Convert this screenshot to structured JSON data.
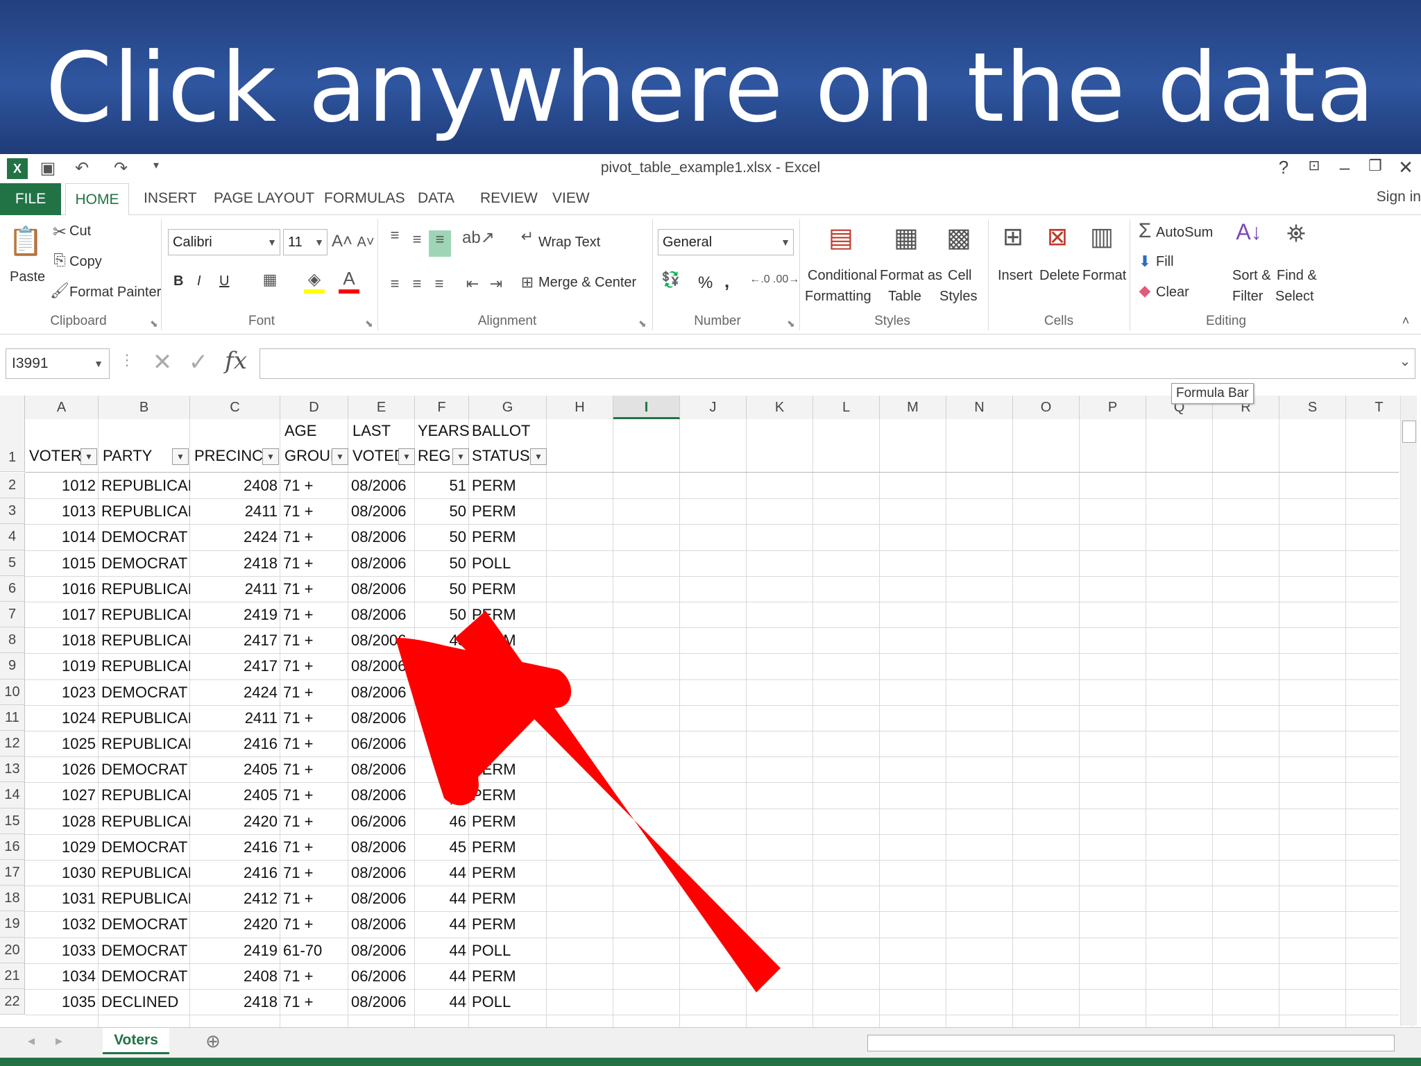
{
  "banner": {
    "title": "Click anywhere on the data"
  },
  "window": {
    "title": "pivot_table_example1.xlsx - Excel",
    "help": "?",
    "sign_in": "Sign in"
  },
  "tabs": [
    "FILE",
    "HOME",
    "INSERT",
    "PAGE LAYOUT",
    "FORMULAS",
    "DATA",
    "REVIEW",
    "VIEW"
  ],
  "ribbon": {
    "clipboard": {
      "paste": "Paste",
      "cut": "Cut",
      "copy": "Copy",
      "format_painter": "Format Painter",
      "label": "Clipboard"
    },
    "font": {
      "name": "Calibri",
      "size": "11",
      "bold": "B",
      "italic": "I",
      "underline": "U",
      "label": "Font"
    },
    "alignment": {
      "wrap": "Wrap Text",
      "merge": "Merge & Center",
      "label": "Alignment"
    },
    "number": {
      "format": "General",
      "percent": "%",
      "comma": ",",
      "label": "Number"
    },
    "styles": {
      "conditional": "Conditional",
      "conditional2": "Formatting",
      "format_as": "Format as",
      "format_as2": "Table",
      "cell": "Cell",
      "cell2": "Styles",
      "label": "Styles"
    },
    "cells": {
      "insert": "Insert",
      "delete": "Delete",
      "format": "Format",
      "label": "Cells"
    },
    "editing": {
      "autosum": "AutoSum",
      "fill": "Fill",
      "clear": "Clear",
      "sort": "Sort &",
      "sort2": "Filter",
      "find": "Find &",
      "find2": "Select",
      "label": "Editing"
    }
  },
  "formula_bar": {
    "name_box": "I3991",
    "value": "",
    "tooltip": "Formula Bar",
    "fx": "fx"
  },
  "columns": [
    "A",
    "B",
    "C",
    "D",
    "E",
    "F",
    "G",
    "H",
    "I",
    "J",
    "K",
    "L",
    "M",
    "N",
    "O",
    "P",
    "Q",
    "R",
    "S",
    "T"
  ],
  "selected_column": "I",
  "headers": {
    "voter": "VOTER",
    "party": "PARTY",
    "precinct": "PRECINCT",
    "age1": "AGE",
    "age2": "GROUP",
    "last1": "LAST",
    "last2": "VOTED",
    "years1": "YEARS",
    "years2": "REG",
    "ballot1": "BALLOT",
    "ballot2": "STATUS"
  },
  "rows": [
    {
      "n": "2",
      "voter": "1012",
      "party": "REPUBLICAN",
      "precinct": "2408",
      "age": "71 +",
      "last": "08/2006",
      "years": "51",
      "ballot": "PERM"
    },
    {
      "n": "3",
      "voter": "1013",
      "party": "REPUBLICAN",
      "precinct": "2411",
      "age": "71 +",
      "last": "08/2006",
      "years": "50",
      "ballot": "PERM"
    },
    {
      "n": "4",
      "voter": "1014",
      "party": "DEMOCRAT",
      "precinct": "2424",
      "age": "71 +",
      "last": "08/2006",
      "years": "50",
      "ballot": "PERM"
    },
    {
      "n": "5",
      "voter": "1015",
      "party": "DEMOCRAT",
      "precinct": "2418",
      "age": "71 +",
      "last": "08/2006",
      "years": "50",
      "ballot": "POLL"
    },
    {
      "n": "6",
      "voter": "1016",
      "party": "REPUBLICAN",
      "precinct": "2411",
      "age": "71 +",
      "last": "08/2006",
      "years": "50",
      "ballot": "PERM"
    },
    {
      "n": "7",
      "voter": "1017",
      "party": "REPUBLICAN",
      "precinct": "2419",
      "age": "71 +",
      "last": "08/2006",
      "years": "50",
      "ballot": "PERM"
    },
    {
      "n": "8",
      "voter": "1018",
      "party": "REPUBLICAN",
      "precinct": "2417",
      "age": "71 +",
      "last": "08/2006",
      "years": "48",
      "ballot": "PERM"
    },
    {
      "n": "9",
      "voter": "1019",
      "party": "REPUBLICAN",
      "precinct": "2417",
      "age": "71 +",
      "last": "08/2006",
      "years": "",
      "ballot": ""
    },
    {
      "n": "10",
      "voter": "1023",
      "party": "DEMOCRAT",
      "precinct": "2424",
      "age": "71 +",
      "last": "08/2006",
      "years": "",
      "ballot": ""
    },
    {
      "n": "11",
      "voter": "1024",
      "party": "REPUBLICAN",
      "precinct": "2411",
      "age": "71 +",
      "last": "08/2006",
      "years": "",
      "ballot": ""
    },
    {
      "n": "12",
      "voter": "1025",
      "party": "REPUBLICAN",
      "precinct": "2416",
      "age": "71 +",
      "last": "06/2006",
      "years": "",
      "ballot": ""
    },
    {
      "n": "13",
      "voter": "1026",
      "party": "DEMOCRAT",
      "precinct": "2405",
      "age": "71 +",
      "last": "08/2006",
      "years": "",
      "ballot": "PERM"
    },
    {
      "n": "14",
      "voter": "1027",
      "party": "REPUBLICAN",
      "precinct": "2405",
      "age": "71 +",
      "last": "08/2006",
      "years": "",
      "ballot": "PERM"
    },
    {
      "n": "15",
      "voter": "1028",
      "party": "REPUBLICAN",
      "precinct": "2420",
      "age": "71 +",
      "last": "06/2006",
      "years": "46",
      "ballot": "PERM"
    },
    {
      "n": "16",
      "voter": "1029",
      "party": "DEMOCRAT",
      "precinct": "2416",
      "age": "71 +",
      "last": "08/2006",
      "years": "45",
      "ballot": "PERM"
    },
    {
      "n": "17",
      "voter": "1030",
      "party": "REPUBLICAN",
      "precinct": "2416",
      "age": "71 +",
      "last": "08/2006",
      "years": "44",
      "ballot": "PERM"
    },
    {
      "n": "18",
      "voter": "1031",
      "party": "REPUBLICAN",
      "precinct": "2412",
      "age": "71 +",
      "last": "08/2006",
      "years": "44",
      "ballot": "PERM"
    },
    {
      "n": "19",
      "voter": "1032",
      "party": "DEMOCRAT",
      "precinct": "2420",
      "age": "71 +",
      "last": "08/2006",
      "years": "44",
      "ballot": "PERM"
    },
    {
      "n": "20",
      "voter": "1033",
      "party": "DEMOCRAT",
      "precinct": "2419",
      "age": "61-70",
      "last": "08/2006",
      "years": "44",
      "ballot": "POLL"
    },
    {
      "n": "21",
      "voter": "1034",
      "party": "DEMOCRAT",
      "precinct": "2408",
      "age": "71 +",
      "last": "06/2006",
      "years": "44",
      "ballot": "PERM"
    },
    {
      "n": "22",
      "voter": "1035",
      "party": "DECLINED",
      "precinct": "2418",
      "age": "71 +",
      "last": "08/2006",
      "years": "44",
      "ballot": "POLL"
    }
  ],
  "sheet_tab": "Voters",
  "colors": {
    "excel_green": "#217346",
    "arrow_red": "#ff0000",
    "banner_blue": "#2f56a0"
  }
}
